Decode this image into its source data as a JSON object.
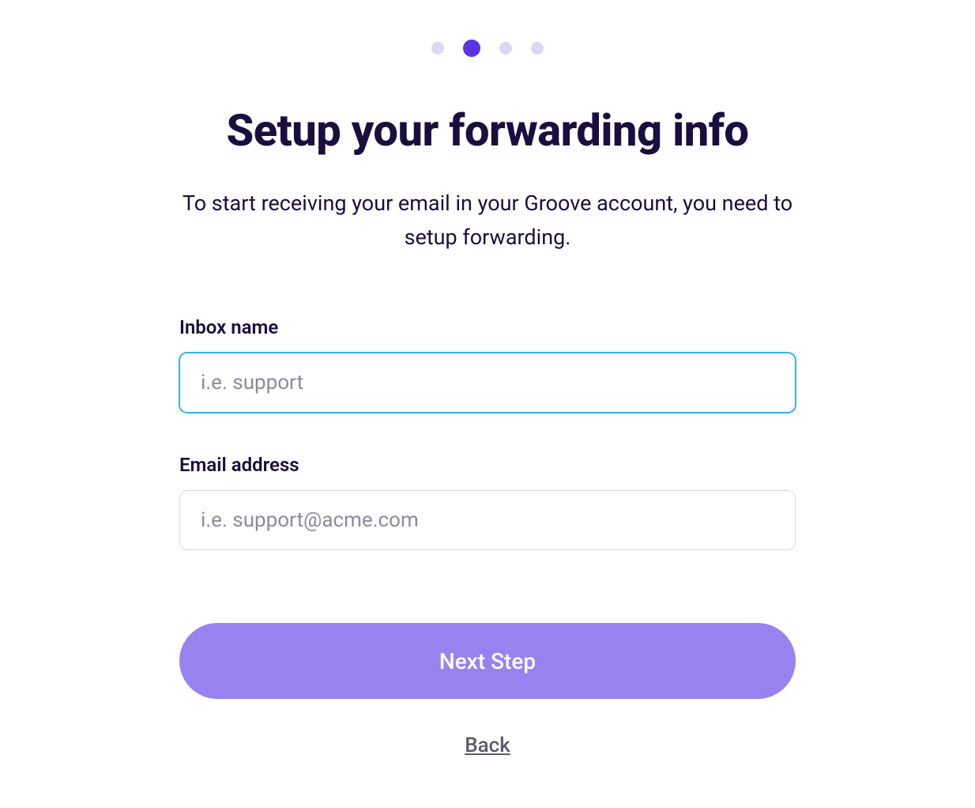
{
  "stepper": {
    "total": 4,
    "active_index": 1
  },
  "header": {
    "title": "Setup your forwarding info",
    "subtitle": "To start receiving your email in your Groove account, you need to setup forwarding."
  },
  "form": {
    "inbox_name": {
      "label": "Inbox name",
      "placeholder": "i.e. support",
      "value": ""
    },
    "email_address": {
      "label": "Email address",
      "placeholder": "i.e. support@acme.com",
      "value": ""
    }
  },
  "actions": {
    "next_label": "Next Step",
    "back_label": "Back"
  }
}
